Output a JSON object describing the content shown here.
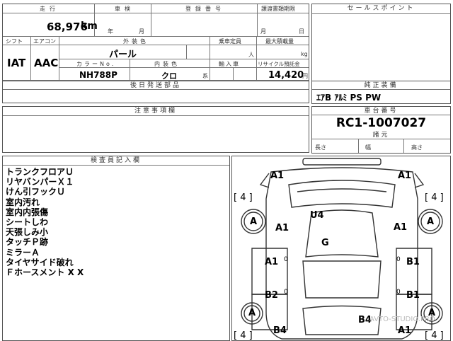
{
  "specs": {
    "mileage_label": "走行",
    "mileage_value": "68,976",
    "mileage_unit": "km",
    "inspection_label": "車検",
    "year_unit": "年",
    "month_unit": "月",
    "registration_label": "登録番号",
    "transfer_deadline_label": "譲渡書類期限",
    "day_unit": "日",
    "shift_label": "シフト",
    "shift_value": "IAT",
    "ac_label": "エアコン",
    "ac_value": "AAC",
    "exterior_color_label": "外装色",
    "exterior_color_value": "パール",
    "capacity_label": "乗車定員",
    "capacity_unit": "人",
    "max_load_label": "最大積載量",
    "max_load_unit": "kg",
    "color_no_label": "カラーNo.",
    "color_no_value": "NH788P",
    "interior_color_label": "内装色",
    "interior_color_value": "クロ",
    "interior_suffix": "系",
    "import_label": "輸入車",
    "recycle_label": "リサイクル預託金",
    "recycle_value": "14,420",
    "recycle_unit": "円",
    "later_parts_label": "後日発送部品",
    "caution_label": "注意事項欄"
  },
  "right": {
    "sales_point_label": "セールスポイント",
    "equipment_label": "純正装備",
    "equipment_value": "ｴｱB ｱﾙﾐ PS PW",
    "chassis_label": "車台番号",
    "chassis_value": "RC1-1007027",
    "dimensions_label": "諸元",
    "length_label": "長さ",
    "width_label": "幅",
    "height_label": "高さ"
  },
  "inspector": {
    "label": "検査員記入欄",
    "notes": [
      "トランクフロアＵ",
      "リヤバンパーＸ１",
      "けん引フックＵ",
      "室内汚れ",
      "室内内張傷",
      "シートしわ",
      "天張しみ小",
      "タッチＰ跡",
      "ミラーＡ",
      "タイヤサイド破れ",
      "Ｆホースメント X X"
    ]
  },
  "diagram": {
    "marks": {
      "top_left": "A1",
      "top_right": "A1",
      "tread_fl": "[ 4 ]",
      "tread_fr": "[ 4 ]",
      "u4": "U4",
      "wheel_rl": "A",
      "a1_left": "A1",
      "a1_right": "A1",
      "g": "G",
      "wheel_rr": "A",
      "a1_door_l": "A1",
      "zero_l1": "0",
      "zero_r1": "0",
      "b1_door_r": "B1",
      "b2_door_l": "B2",
      "zero_l2": "0",
      "zero_r2": "0",
      "b1_door_r2": "B1",
      "wheel_fl": "A",
      "wheel_fr": "A",
      "b4_left": "B4",
      "b4_right": "B4",
      "a1_bottom_right": "A1",
      "tread_rl": "[ 4 ]",
      "tread_rr": "[ 4 ]"
    },
    "watermark": "AVTO-STUDIO.PRO"
  }
}
